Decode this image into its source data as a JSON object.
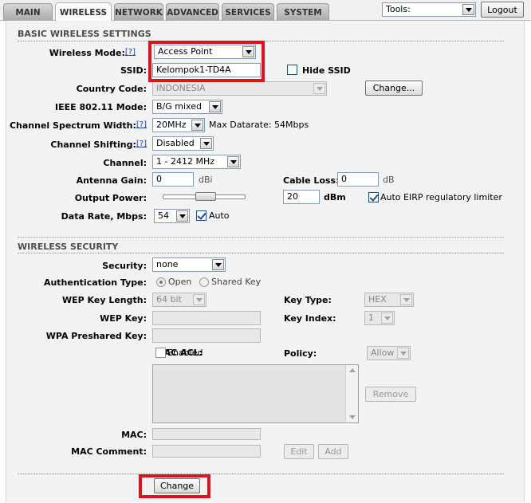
{
  "tabs": [
    "MAIN",
    "WIRELESS",
    "NETWORK",
    "ADVANCED",
    "SERVICES",
    "SYSTEM"
  ],
  "tools": {
    "value": "Tools:",
    "logout": "Logout"
  },
  "basic": {
    "title": "BASIC WIRELESS SETTINGS",
    "help": "[?]",
    "wireless_mode": {
      "label": "Wireless Mode:",
      "value": "Access Point"
    },
    "ssid": {
      "label": "SSID:",
      "value": "Kelompok1-TD4A",
      "hide_label": "Hide SSID"
    },
    "country": {
      "label": "Country Code:",
      "value": "INDONESIA",
      "change": "Change..."
    },
    "ieee": {
      "label": "IEEE 802.11 Mode:",
      "value": "B/G mixed"
    },
    "spectrum": {
      "label": "Channel Spectrum Width:",
      "value": "20MHz",
      "datarate": "Max Datarate: 54Mbps"
    },
    "shifting": {
      "label": "Channel Shifting:",
      "value": "Disabled"
    },
    "channel": {
      "label": "Channel:",
      "value": "1 - 2412 MHz"
    },
    "antenna": {
      "label": "Antenna Gain:",
      "value": "0",
      "unit": "dBi"
    },
    "cable": {
      "label": "Cable Loss:",
      "value": "0",
      "unit": "dB"
    },
    "output": {
      "label": "Output Power:",
      "value": "20",
      "unit": "dBm",
      "eirp": "Auto EIRP regulatory limiter"
    },
    "datarate": {
      "label": "Data Rate, Mbps:",
      "value": "54",
      "auto": "Auto"
    }
  },
  "security": {
    "title": "WIRELESS SECURITY",
    "security": {
      "label": "Security:",
      "value": "none"
    },
    "auth": {
      "label": "Authentication Type:",
      "open": "Open",
      "shared": "Shared Key"
    },
    "wep_len": {
      "label": "WEP Key Length:",
      "value": "64 bit"
    },
    "key_type": {
      "label": "Key Type:",
      "value": "HEX"
    },
    "wep_key": {
      "label": "WEP Key:"
    },
    "key_index": {
      "label": "Key Index:",
      "value": "1"
    },
    "wpa": {
      "label": "WPA Preshared Key:"
    },
    "mac_acl": {
      "label": "MAC ACL:",
      "enabled": "Enabled"
    },
    "policy": {
      "label": "Policy:",
      "value": "Allow"
    },
    "remove": "Remove",
    "mac": {
      "label": "MAC:"
    },
    "mac_comment": {
      "label": "MAC Comment:"
    },
    "edit": "Edit",
    "add": "Add"
  },
  "footer": {
    "change": "Change"
  },
  "colors": {
    "highlight": "#e3101e",
    "help_link": "#1a3fa8"
  }
}
